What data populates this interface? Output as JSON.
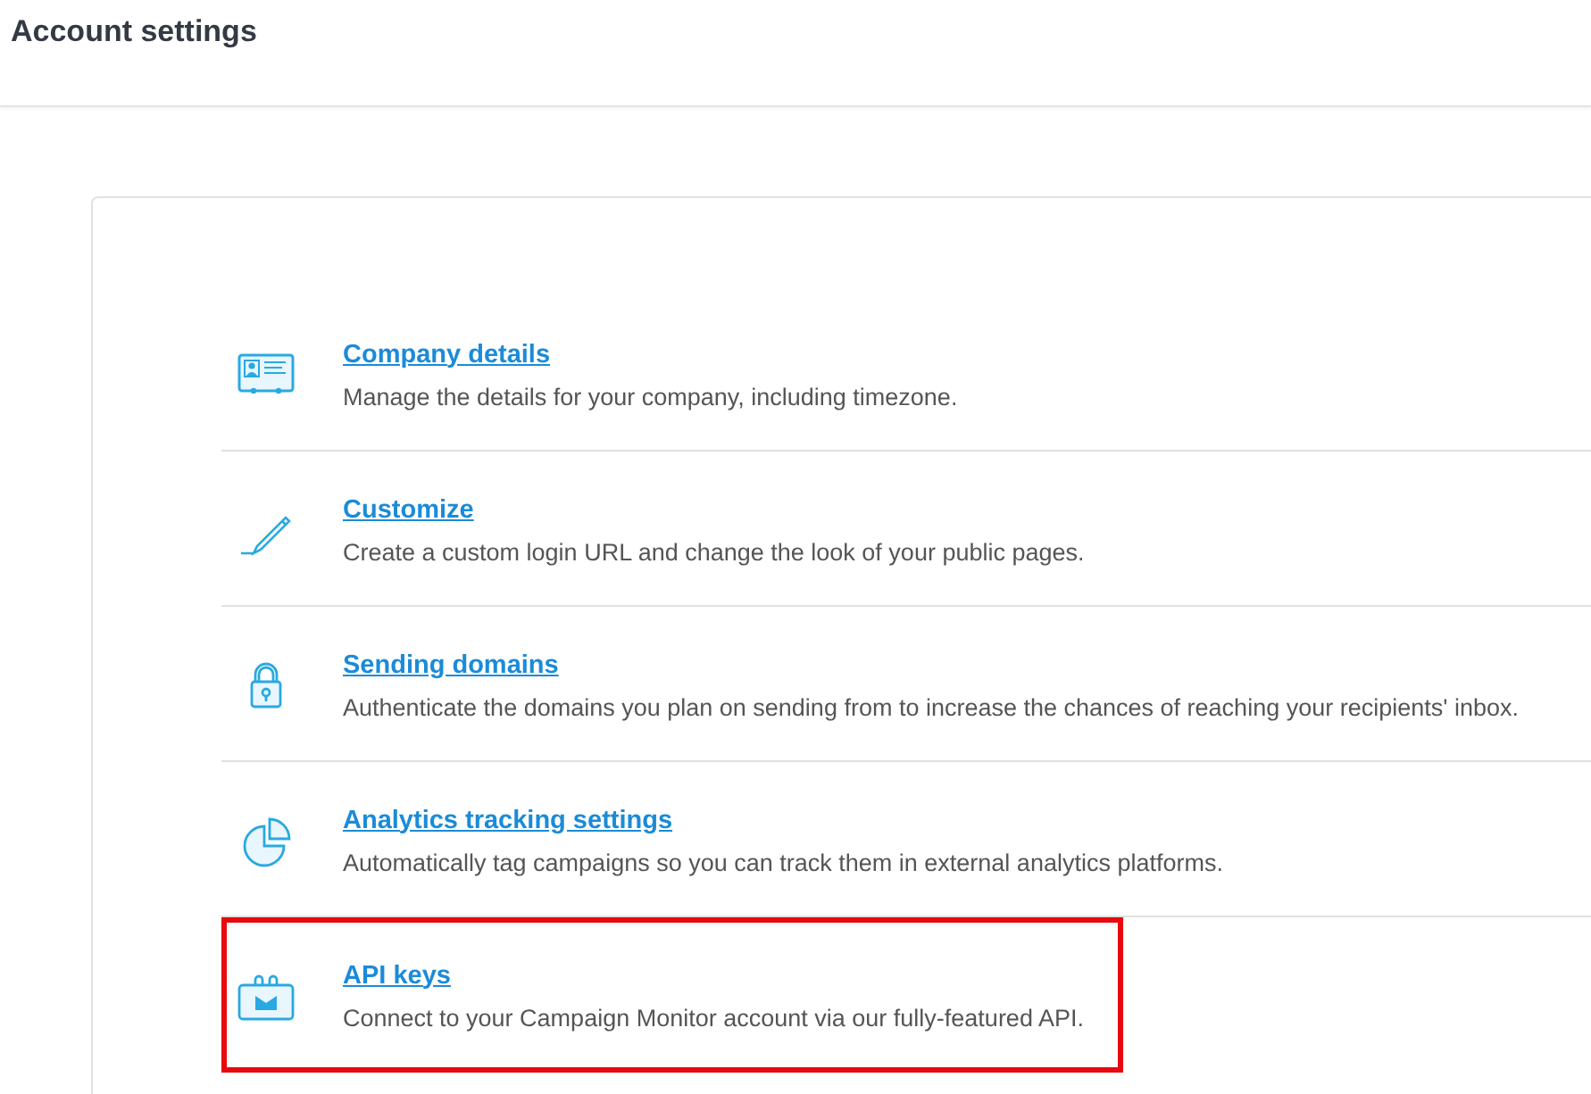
{
  "page_title": "Account settings",
  "settings": [
    {
      "title": "Company details",
      "description": "Manage the details for your company, including timezone.",
      "highlighted": false
    },
    {
      "title": "Customize",
      "description": "Create a custom login URL and change the look of your public pages.",
      "highlighted": false
    },
    {
      "title": "Sending domains",
      "description": "Authenticate the domains you plan on sending from to increase the chances of reaching your recipients' inbox.",
      "highlighted": false
    },
    {
      "title": "Analytics tracking settings",
      "description": "Automatically tag campaigns so you can track them in external analytics platforms.",
      "highlighted": false
    },
    {
      "title": "API keys",
      "description": "Connect to your Campaign Monitor account via our fully-featured API.",
      "highlighted": true
    }
  ]
}
